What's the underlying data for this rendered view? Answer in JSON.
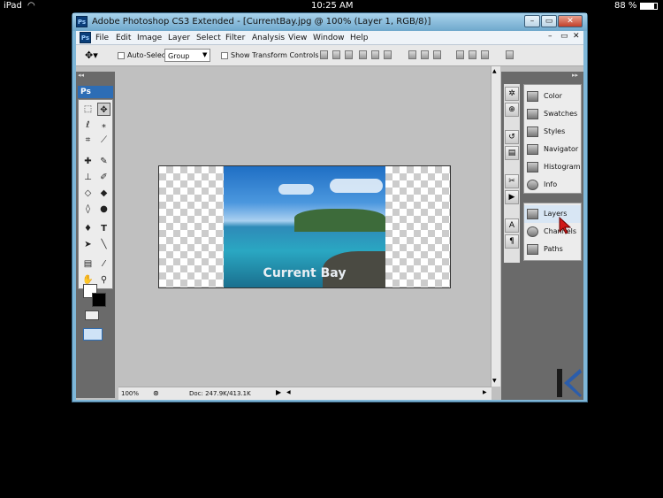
{
  "status_bar": {
    "device": "iPad",
    "time": "10:25 AM",
    "battery": "88 %"
  },
  "window": {
    "title": "Adobe Photoshop CS3 Extended - [CurrentBay.jpg @ 100% (Layer 1, RGB/8)]",
    "logo": "Ps",
    "menu_logo": "Ps",
    "controls": {
      "minimize": "–",
      "restore": "▭",
      "close": "✕"
    },
    "doc_controls": {
      "minimize": "–",
      "restore": "▭",
      "close": "✕"
    }
  },
  "menus": [
    "File",
    "Edit",
    "Image",
    "Layer",
    "Select",
    "Filter",
    "Analysis",
    "View",
    "Window",
    "Help"
  ],
  "options_bar": {
    "auto_select_label": "Auto-Select:",
    "auto_select_value": "Group",
    "transform_label": "Show Transform Controls"
  },
  "toolbox": {
    "header": "Ps"
  },
  "image": {
    "caption": "Current Bay"
  },
  "status": {
    "zoom": "100%",
    "doc": "Doc: 247.9K/413.1K"
  },
  "panels": {
    "group1": [
      "Color",
      "Swatches",
      "Styles",
      "Navigator",
      "Histogram",
      "Info"
    ],
    "group2": [
      "Layers",
      "Channels",
      "Paths"
    ]
  },
  "colors": {
    "accent": "#2d6db5",
    "canvas_bg": "#c0c0c0",
    "panel_dark": "#6a6a6a"
  },
  "icons": {
    "wifi": "wifi-icon",
    "move": "move-tool-icon",
    "pointer": "red-cursor-icon"
  }
}
